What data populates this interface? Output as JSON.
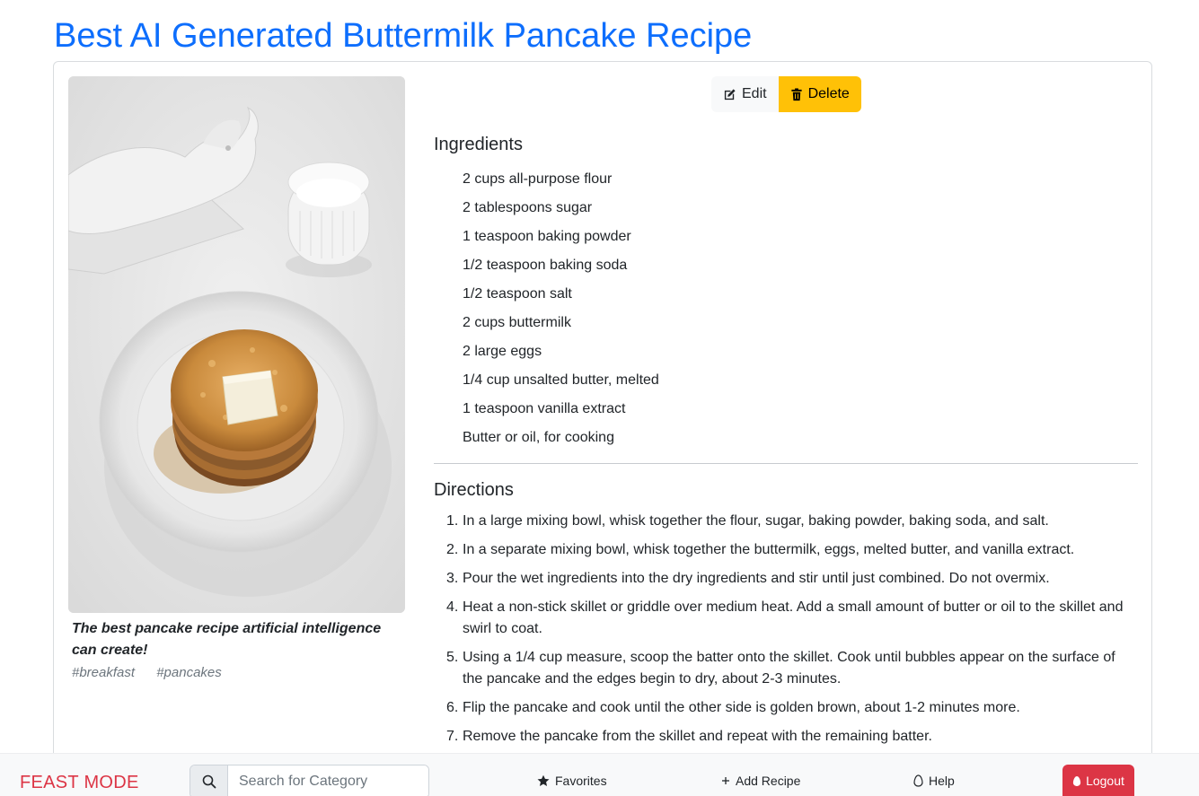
{
  "page": {
    "title": "Best AI Generated Buttermilk Pancake Recipe"
  },
  "recipe": {
    "caption": "The best pancake recipe artificial intelligence can create!",
    "tags": [
      "#breakfast",
      "#pancakes"
    ],
    "actions": {
      "edit_label": "Edit",
      "delete_label": "Delete"
    },
    "ingredients_heading": "Ingredients",
    "ingredients": [
      "2 cups all-purpose flour",
      "2 tablespoons sugar",
      "1 teaspoon baking powder",
      "1/2 teaspoon baking soda",
      "1/2 teaspoon salt",
      "2 cups buttermilk",
      "2 large eggs",
      "1/4 cup unsalted butter, melted",
      "1 teaspoon vanilla extract",
      "Butter or oil, for cooking"
    ],
    "directions_heading": "Directions",
    "directions": [
      "In a large mixing bowl, whisk together the flour, sugar, baking powder, baking soda, and salt.",
      "In a separate mixing bowl, whisk together the buttermilk, eggs, melted butter, and vanilla extract.",
      "Pour the wet ingredients into the dry ingredients and stir until just combined. Do not overmix.",
      "Heat a non-stick skillet or griddle over medium heat. Add a small amount of butter or oil to the skillet and swirl to coat.",
      "Using a 1/4 cup measure, scoop the batter onto the skillet. Cook until bubbles appear on the surface of the pancake and the edges begin to dry, about 2-3 minutes.",
      "Flip the pancake and cook until the other side is golden brown, about 1-2 minutes more.",
      "Remove the pancake from the skillet and repeat with the remaining batter."
    ],
    "direction_numbers": [
      "1.",
      "2.",
      "3.",
      "4.",
      "5.",
      "6.",
      "7."
    ]
  },
  "nav": {
    "brand": "FEAST MODE",
    "search_placeholder": "Search for Category",
    "favorites_label": "Favorites",
    "add_recipe_label": "Add Recipe",
    "help_label": "Help",
    "logout_label": "Logout"
  },
  "icons": {
    "edit": "pencil-square-icon",
    "delete": "trash-icon",
    "search": "search-icon",
    "favorites": "star-icon",
    "add": "plus-icon",
    "help": "egg-icon",
    "logout": "egg-fill-icon"
  },
  "colors": {
    "title": "#0d6efd",
    "brand": "#dc3545",
    "delete_button": "#ffc107",
    "logout_button": "#dc3545"
  }
}
